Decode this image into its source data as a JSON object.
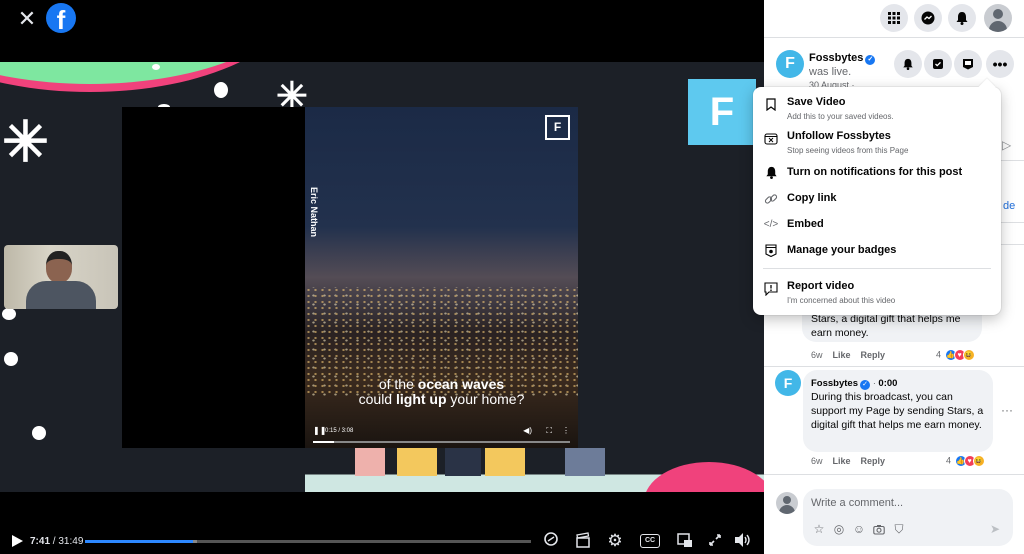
{
  "topbar": {
    "close_icon": "close-icon",
    "logo_letter": "f"
  },
  "video": {
    "credit": "Eric Nathan",
    "watermark": "F",
    "subtitle_line1_pre": "of the ",
    "subtitle_line1_bold": "ocean waves",
    "subtitle_line2_pre": "could ",
    "subtitle_line2_bold": "light up",
    "subtitle_line2_post": " your home?",
    "inner_time": "0:15 / 3:08",
    "inner_progress": 0.08,
    "brand_tile": "F"
  },
  "player": {
    "current_time": "7:41",
    "separator": " / ",
    "total_time": "31:49",
    "progress": 0.2415,
    "buffered": 0.25,
    "icons": [
      "chat-icon",
      "clapperboard-icon",
      "settings-icon",
      "captions-icon",
      "picture-in-picture-icon",
      "fullscreen-icon",
      "volume-icon"
    ],
    "captions_label": "CC"
  },
  "sidebar": {
    "top_icons": [
      "menu-grid-icon",
      "messenger-icon",
      "notifications-icon",
      "account-avatar"
    ],
    "post": {
      "page_name": "Fossbytes",
      "status": "was live.",
      "date": "30 August · ",
      "action_icons": [
        "bell-icon",
        "unfollow-icon",
        "badge-icon",
        "more-icon"
      ]
    },
    "menu": {
      "items": [
        {
          "label": "Save Video",
          "sub": "Add this to your saved videos.",
          "icon": "bookmark-icon"
        },
        {
          "label": "Unfollow Fossbytes",
          "sub": "Stop seeing videos from this Page",
          "icon": "unfollow-icon"
        },
        {
          "label": "Turn on notifications for this post",
          "sub": "",
          "icon": "bell-icon"
        },
        {
          "label": "Copy link",
          "sub": "",
          "icon": "link-icon"
        },
        {
          "label": "Embed",
          "sub": "",
          "icon": "embed-icon"
        },
        {
          "label": "Manage your badges",
          "sub": "",
          "icon": "badge-icon"
        },
        {
          "label": "Report video",
          "sub": "I'm concerned about this video",
          "icon": "report-icon"
        }
      ]
    },
    "background_link_fragment": "de",
    "comments": [
      {
        "text_visible": "Stars, a digital gift that helps me earn money.",
        "age": "6w",
        "like": "Like",
        "reply": "Reply",
        "reaction_count": "4"
      },
      {
        "author": "Fossbytes",
        "time": "0:00",
        "text": "During this broadcast, you can support my Page by sending Stars, a digital gift that helps me earn money.",
        "age": "6w",
        "like": "Like",
        "reply": "Reply",
        "reaction_count": "4"
      }
    ],
    "composer": {
      "placeholder": "Write a comment...",
      "icons": [
        "avatar-sticker-icon",
        "gif-icon",
        "emoji-icon",
        "camera-icon",
        "sticker-icon",
        "send-icon"
      ]
    }
  },
  "colors": {
    "accent": "#1877f2",
    "progress": "#2d88ff",
    "brand_tile": "#5ec9ef"
  }
}
